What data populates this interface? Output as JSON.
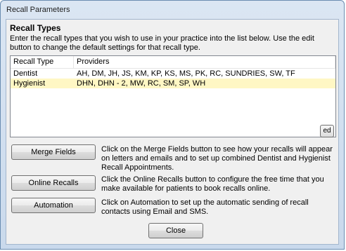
{
  "window": {
    "title": "Recall Parameters"
  },
  "section": {
    "title": "Recall Types",
    "intro": "Enter the recall types that you wish to use in your practice into the list below. Use the edit button to change the default settings for that recall type."
  },
  "table": {
    "headers": [
      "Recall Type",
      "Providers"
    ],
    "rows": [
      {
        "type": "Dentist",
        "providers": "AH, DM, JH, JS, KM, KP, KS, MS, PK, RC, SUNDRIES, SW, TF"
      },
      {
        "type": "Hygienist",
        "providers": "DHN, DHN - 2, MW, RC, SM, SP, WH"
      }
    ]
  },
  "edit_button": {
    "label": "ed"
  },
  "actions": [
    {
      "label": "Merge Fields",
      "description": "Click on the Merge Fields button to see how your recalls will appear on letters and emails and to set up combined Dentist and Hygienist Recall Appointments."
    },
    {
      "label": "Online Recalls",
      "description": "Click the Online Recalls button to configure the free time that you make available for patients to book recalls online."
    },
    {
      "label": "Automation",
      "description": "Click on Automation to set up the automatic sending of recall contacts using Email and SMS."
    }
  ],
  "close_button": {
    "label": "Close"
  }
}
